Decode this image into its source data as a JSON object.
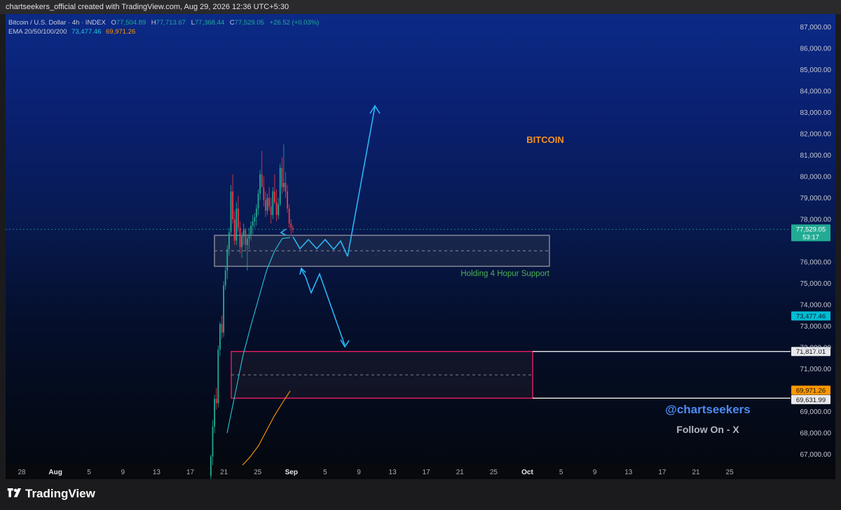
{
  "header": {
    "credit": "chartseekers_official created with TradingView.com, Aug 29, 2026 12:36 UTC+5:30"
  },
  "legend": {
    "symbol": "Bitcoin / U.S. Dollar · 4h · INDEX",
    "open_label": "O",
    "open": "77,504.89",
    "high_label": "H",
    "high": "77,713.67",
    "low_label": "L",
    "low": "77,368.44",
    "close_label": "C",
    "close": "77,529.05",
    "change": "+26.52 (+0.03%)",
    "ema_label": "EMA 20/50/100/200",
    "ema_1": "73,477.46",
    "ema_2": "69,971.26"
  },
  "footer": {
    "brand": "TradingView"
  },
  "colors": {
    "up": "#22ab94",
    "down": "#f23645",
    "ema_1": "#26c6da",
    "ema_2": "#ff9800",
    "arrow": "#29b6f6",
    "support_zone": "#9e9ea6",
    "target_zone": "#e91e63",
    "title": "#f7931a",
    "handle": "#4c8bf5"
  },
  "chart_data": {
    "type": "candlestick",
    "y_range": [
      66500,
      87600
    ],
    "price_ticks": [
      "87,000.00",
      "86,000.00",
      "85,000.00",
      "84,000.00",
      "83,000.00",
      "82,000.00",
      "81,000.00",
      "80,000.00",
      "79,000.00",
      "78,000.00",
      "76,000.00",
      "75,000.00",
      "74,000.00",
      "73,000.00",
      "72,000.00",
      "71,000.00",
      "69,000.00",
      "68,000.00",
      "67,000.00"
    ],
    "time_ticks": [
      "28",
      "Aug",
      "5",
      "9",
      "13",
      "17",
      "21",
      "25",
      "Sep",
      "5",
      "9",
      "13",
      "17",
      "21",
      "25",
      "Oct",
      "5",
      "9",
      "13",
      "17",
      "21",
      "25"
    ],
    "candles": [
      [
        66000,
        67000,
        65600,
        66900
      ],
      [
        66900,
        68600,
        66500,
        68300
      ],
      [
        68300,
        69800,
        68000,
        69600
      ],
      [
        69600,
        70100,
        69100,
        69400
      ],
      [
        69400,
        72100,
        69200,
        71900
      ],
      [
        71900,
        73200,
        71600,
        73100
      ],
      [
        73100,
        73500,
        72400,
        72700
      ],
      [
        72700,
        75100,
        72500,
        74900
      ],
      [
        74900,
        75800,
        74700,
        75600
      ],
      [
        75600,
        76800,
        75200,
        76600
      ],
      [
        76600,
        77600,
        76300,
        77400
      ],
      [
        77400,
        79600,
        77200,
        79300
      ],
      [
        79300,
        80100,
        77800,
        78000
      ],
      [
        78000,
        78400,
        76800,
        77000
      ],
      [
        77000,
        78800,
        76800,
        78500
      ],
      [
        78500,
        79100,
        77400,
        77600
      ],
      [
        77600,
        77900,
        76400,
        76700
      ],
      [
        76700,
        77400,
        76200,
        77200
      ],
      [
        77200,
        77800,
        76800,
        77500
      ],
      [
        77500,
        77600,
        76500,
        76800
      ],
      [
        76800,
        77300,
        75600,
        77100
      ],
      [
        77100,
        77600,
        76600,
        77300
      ],
      [
        77300,
        77900,
        77000,
        77700
      ],
      [
        77700,
        78200,
        77300,
        77900
      ],
      [
        77900,
        78300,
        77600,
        78100
      ],
      [
        78100,
        78700,
        77700,
        78500
      ],
      [
        78500,
        79400,
        78200,
        79200
      ],
      [
        79200,
        80300,
        78900,
        80100
      ],
      [
        80100,
        81200,
        79600,
        79500
      ],
      [
        79500,
        80000,
        78600,
        78900
      ],
      [
        78900,
        79300,
        78100,
        78400
      ],
      [
        78400,
        79200,
        78200,
        79000
      ],
      [
        79000,
        79500,
        78400,
        78600
      ],
      [
        78600,
        79000,
        77800,
        78200
      ],
      [
        78200,
        79500,
        78000,
        79300
      ],
      [
        79300,
        80100,
        78700,
        78800
      ],
      [
        78800,
        79400,
        77900,
        78200
      ],
      [
        78200,
        79000,
        78000,
        78700
      ],
      [
        78700,
        80600,
        78600,
        80400
      ],
      [
        80400,
        80900,
        79200,
        79500
      ],
      [
        79500,
        81500,
        79300,
        79700
      ],
      [
        79700,
        80200,
        79000,
        79300
      ],
      [
        79300,
        79600,
        78300,
        78500
      ],
      [
        78500,
        78700,
        77600,
        77800
      ],
      [
        77800,
        78000,
        77300,
        77600
      ],
      [
        77600,
        77713.67,
        77368.44,
        77529.05
      ]
    ],
    "ema_1_values": [
      68000,
      69800,
      71600,
      73000,
      74300,
      75600,
      76500,
      77100,
      77150
    ],
    "ema_2_values": [
      66500,
      66900,
      67400,
      68100,
      68800,
      69400,
      69971.26
    ],
    "current_price": {
      "value": "77,529.05",
      "countdown": "53:17"
    },
    "ema_1_last": "73,477.46",
    "ema_2_last": "69,971.26",
    "support_zone": {
      "top": 77250,
      "bottom": 75800,
      "label": "Holding 4 Hopur Support"
    },
    "target_zone": {
      "top": 71817.01,
      "bottom": 69631.99,
      "top_label": "71,817.01",
      "bottom_label": "69,631.99"
    },
    "annotations": {
      "title": "BITCOIN",
      "handle": "@chartseekers",
      "follow": "Follow On - X"
    }
  }
}
